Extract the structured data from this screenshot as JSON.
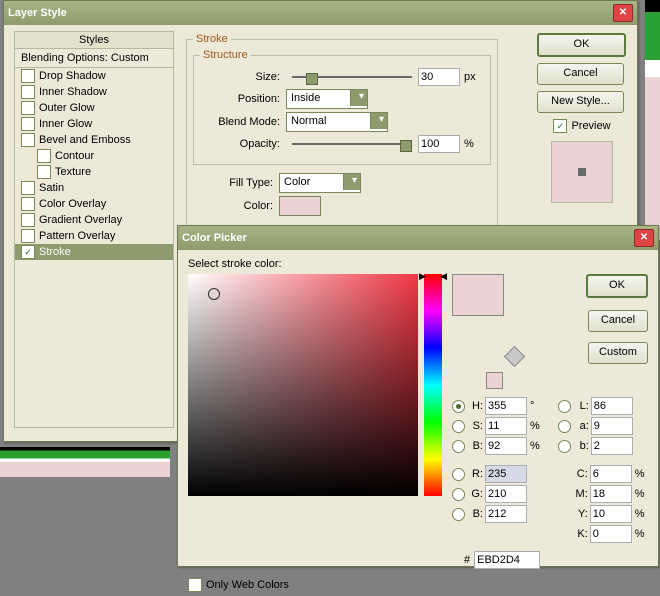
{
  "ls": {
    "title": "Layer Style",
    "stylesHeader": "Styles",
    "blending": "Blending Options: Custom",
    "items": [
      "Drop Shadow",
      "Inner Shadow",
      "Outer Glow",
      "Inner Glow",
      "Bevel and Emboss",
      "Contour",
      "Texture",
      "Satin",
      "Color Overlay",
      "Gradient Overlay",
      "Pattern Overlay",
      "Stroke"
    ],
    "btn": {
      "ok": "OK",
      "cancel": "Cancel",
      "newstyle": "New Style..."
    },
    "preview": "Preview",
    "stroke": {
      "legend": "Stroke",
      "structure": "Structure",
      "size": "Size:",
      "sizeVal": "30",
      "px": "px",
      "position": "Position:",
      "positionVal": "Inside",
      "blend": "Blend Mode:",
      "blendVal": "Normal",
      "opacity": "Opacity:",
      "opacityVal": "100",
      "pct": "%",
      "fillType": "Fill Type:",
      "fillTypeVal": "Color",
      "color": "Color:"
    }
  },
  "cp": {
    "title": "Color Picker",
    "prompt": "Select stroke color:",
    "btn": {
      "ok": "OK",
      "cancel": "Cancel",
      "custom": "Custom"
    },
    "onlyWeb": "Only Web Colors",
    "hash": "#",
    "hex": "EBD2D4",
    "deg": "°",
    "pct": "%",
    "H": "355",
    "S": "11",
    "Bv": "92",
    "R": "235",
    "G": "210",
    "B": "212",
    "L": "86",
    "a": "9",
    "b": "2",
    "C": "6",
    "M": "18",
    "Y": "10",
    "K": "0",
    "lab": {
      "H": "H:",
      "S": "S:",
      "Bv": "B:",
      "R": "R:",
      "G": "G:",
      "B": "B:",
      "L": "L:",
      "a": "a:",
      "b": "b:",
      "C": "C:",
      "M": "M:",
      "Y": "Y:",
      "K": "K:"
    }
  }
}
